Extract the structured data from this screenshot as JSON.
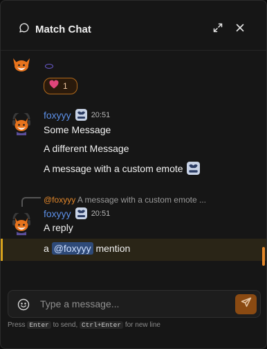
{
  "header": {
    "title": "Match Chat",
    "icons": {
      "chat": "chat-bubble-icon",
      "expand": "expand-icon",
      "close": "close-icon"
    }
  },
  "messages": {
    "group1": {
      "reaction": {
        "emoji": "heart",
        "count": "1"
      }
    },
    "group2": {
      "author": "foxyyy",
      "time": "20:51",
      "lines": [
        "Some Message",
        "A different Message",
        "A message with a custom emote"
      ]
    },
    "group3": {
      "reply_to": {
        "author": "@foxyyy",
        "preview": "A message with a custom emote ..."
      },
      "author": "foxyyy",
      "time": "20:51",
      "lines": [
        "A reply"
      ],
      "mention_line": {
        "before": "a ",
        "mention": "@foxyyy",
        "after": " mention"
      }
    }
  },
  "composer": {
    "placeholder": "Type a message...",
    "hint": {
      "press": "Press",
      "key_send": "Enter",
      "to_send": "to send,",
      "key_newline": "Ctrl+Enter",
      "for_newline": "for new line"
    }
  },
  "colors": {
    "accent": "#e3872a",
    "username": "#5c8fe6",
    "mention_bg": "#2e4a78",
    "highlight_border": "#d8a21c",
    "background": "#161616"
  }
}
